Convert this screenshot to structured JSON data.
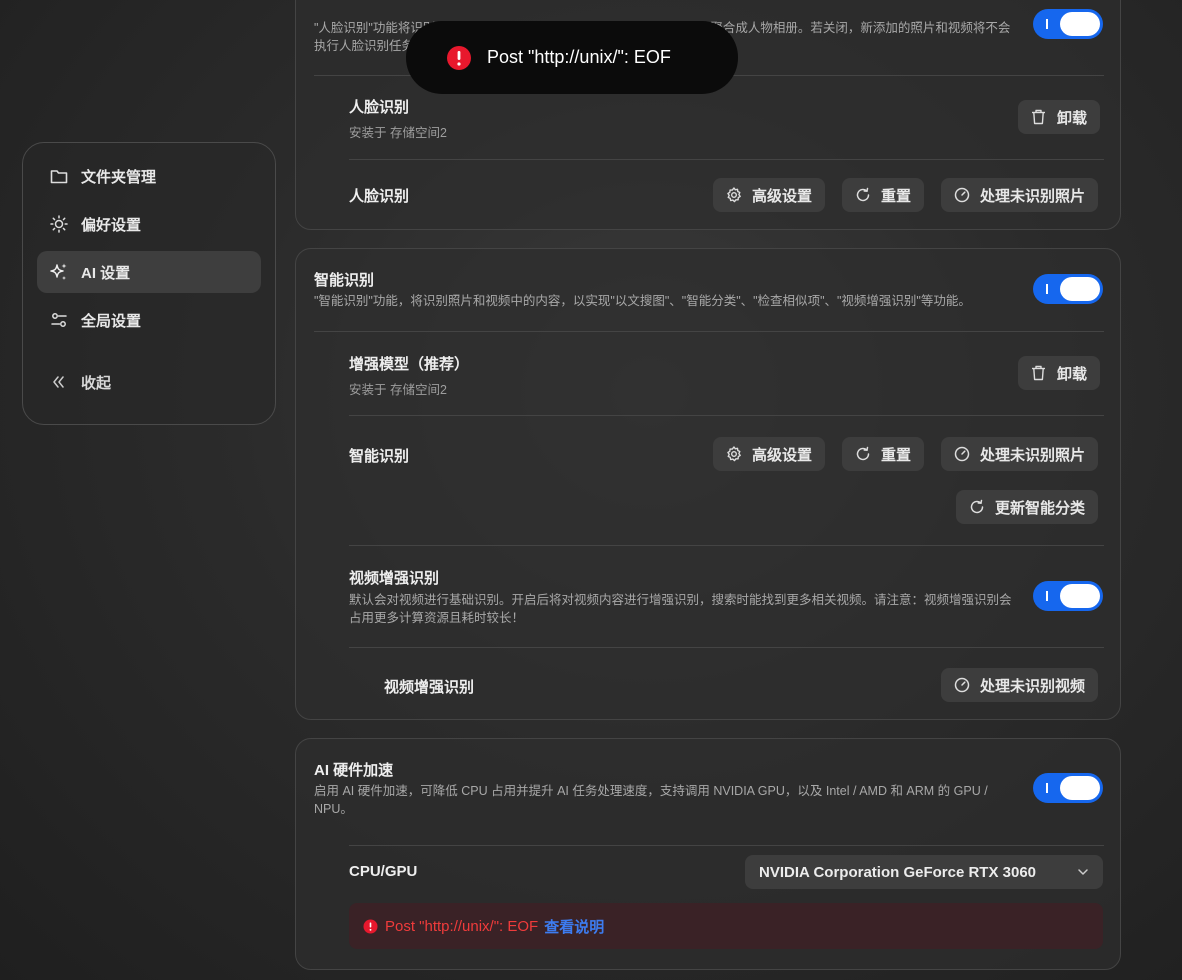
{
  "toast": {
    "message": "Post \"http://unix/\": EOF",
    "icon": "error-icon"
  },
  "sidebar": {
    "items": [
      {
        "label": "文件夹管理",
        "icon": "folder-icon"
      },
      {
        "label": "偏好设置",
        "icon": "sun-icon"
      },
      {
        "label": "AI 设置",
        "icon": "sparkle-icon",
        "active": true
      },
      {
        "label": "全局设置",
        "icon": "sliders-icon"
      }
    ],
    "collapse_label": "收起"
  },
  "face_card": {
    "desc": "\"人脸识别\"功能将识别照片和视频中的人脸，并将同一个人的照片和视频聚合成人物相册。若关闭，新添加的照片和视频将不会执行人脸识别任务，已识别的人物将保留。",
    "toggle_on": true,
    "model_name": "人脸识别",
    "model_location": "安装于 存储空间2",
    "uninstall_label": "卸载",
    "action_row_label": "人脸识别",
    "advanced_label": "高级设置",
    "reset_label": "重置",
    "process_label": "处理未识别照片"
  },
  "smart_card": {
    "title": "智能识别",
    "desc": "\"智能识别\"功能，将识别照片和视频中的内容，以实现\"以文搜图\"、\"智能分类\"、\"检查相似项\"、\"视频增强识别\"等功能。",
    "toggle_on": true,
    "model_name": "增强模型（推荐）",
    "model_location": "安装于 存储空间2",
    "uninstall_label": "卸载",
    "action_row_label": "智能识别",
    "advanced_label": "高级设置",
    "reset_label": "重置",
    "process_label": "处理未识别照片",
    "update_label": "更新智能分类",
    "video_title": "视频增强识别",
    "video_desc": "默认会对视频进行基础识别。开启后将对视频内容进行增强识别，搜索时能找到更多相关视频。请注意：视频增强识别会占用更多计算资源且耗时较长！",
    "video_toggle_on": true,
    "video_row_label": "视频增强识别",
    "process_video_label": "处理未识别视频"
  },
  "hw_card": {
    "title": "AI 硬件加速",
    "desc": "启用 AI 硬件加速，可降低 CPU 占用并提升 AI 任务处理速度，支持调用 NVIDIA GPU，以及 Intel / AMD 和 ARM 的 GPU / NPU。",
    "toggle_on": true,
    "device_label": "CPU/GPU",
    "device_value": "NVIDIA Corporation GeForce RTX 3060",
    "error_text": "Post \"http://unix/\": EOF",
    "error_link": "查看说明"
  },
  "colors": {
    "accent": "#1667ee",
    "error": "#ef3b3b",
    "link": "#3d7cf0"
  }
}
